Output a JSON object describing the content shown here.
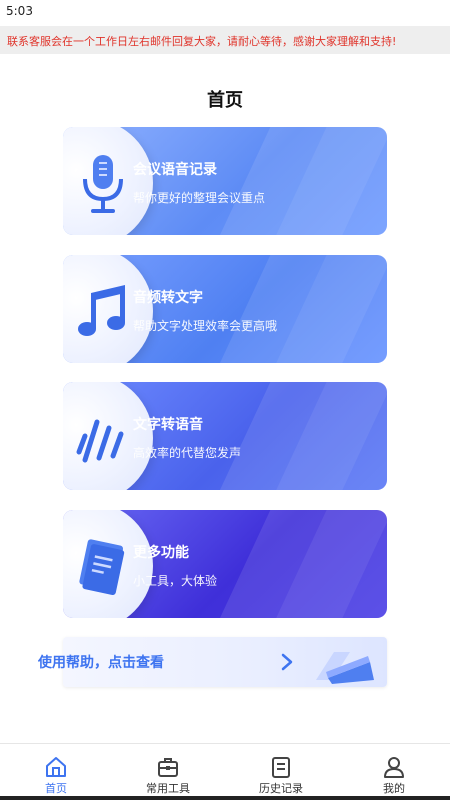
{
  "status_bar": {
    "time": "5:03"
  },
  "notice": {
    "text": "联系客服会在一个工作日左右邮件回复大家，请耐心等待，感谢大家理解和支持!"
  },
  "page": {
    "title": "首页"
  },
  "cards": [
    {
      "title": "会议语音记录",
      "subtitle": "帮你更好的整理会议重点",
      "icon": "microphone-icon"
    },
    {
      "title": "音频转文字",
      "subtitle": "帮助文字处理效率会更高哦",
      "icon": "music-note-icon"
    },
    {
      "title": "文字转语音",
      "subtitle": "高效率的代替您发声",
      "icon": "sound-wave-icon"
    },
    {
      "title": "更多功能",
      "subtitle": "小工具，大体验",
      "icon": "book-icon"
    }
  ],
  "help": {
    "text": "使用帮助，点击查看"
  },
  "tabs": [
    {
      "label": "首页",
      "icon": "home-icon",
      "active": true
    },
    {
      "label": "常用工具",
      "icon": "toolbox-icon",
      "active": false
    },
    {
      "label": "历史记录",
      "icon": "document-icon",
      "active": false
    },
    {
      "label": "我的",
      "icon": "user-icon",
      "active": false
    }
  ],
  "colors": {
    "accent": "#3e74f0",
    "notice": "#e0342b"
  }
}
